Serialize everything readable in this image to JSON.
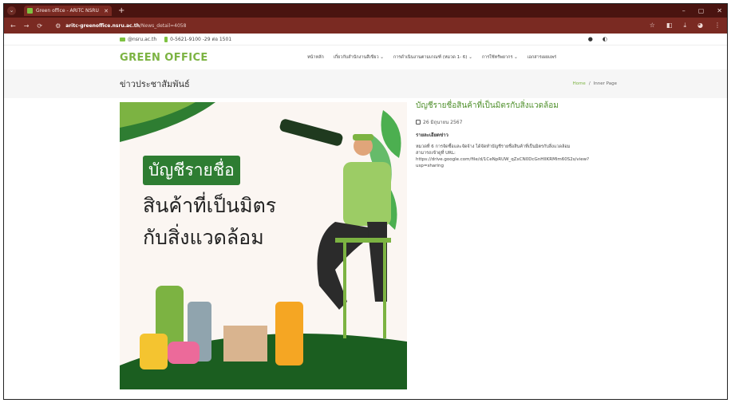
{
  "browser": {
    "tab_title": "Green office - ARITC NSRU",
    "url_host": "aritc-greenoffice.nsru.ac.th",
    "url_path": "/News_detail=4058"
  },
  "topbar": {
    "email": "@nsru.ac.th",
    "phone": "0-5621-9100 -29 ต่อ 1501"
  },
  "header": {
    "logo": "GREEN OFFICE",
    "menu": [
      "หน้าหลัก",
      "เกี่ยวกับสำนักงานสีเขียว ⌄",
      "การดำเนินงานตามเกณฑ์ (หมวด 1- 6) ⌄",
      "การใช้ทรัพยากร ⌄",
      "เอกสารเผยแพร่"
    ]
  },
  "page_head": {
    "title": "ข่าวประชาสัมพันธ์",
    "crumb_home": "Home",
    "crumb_sep": "/",
    "crumb_current": "Inner Page"
  },
  "hero": {
    "line1": "บัญชีรายชื่อ",
    "line2": "สินค้าที่เป็นมิตร",
    "line3": "กับสิ่งแวดล้อม"
  },
  "post": {
    "title": "บัญชีรายชื่อสินค้าที่เป็นมิตรกับสิ่งแวดล้อม",
    "date": "26 มิถุนายน 2567",
    "subheading": "รายละเอียดข่าว",
    "body1": "หมวดที่ 6 การจัดซื้อและจัดจ้าง ได้จัดทำบัญชีรายชื่อสินค้าที่เป็นมิตรกับสิ่งแวดล้อม",
    "body2": "สามารถเข้าดูที่ URL:",
    "body3": "https://drive.google.com/file/d/1CeNpRUW_qZxCN0DcGnHIIKRMlm60S2s/view?",
    "body4": "usp=sharing"
  }
}
